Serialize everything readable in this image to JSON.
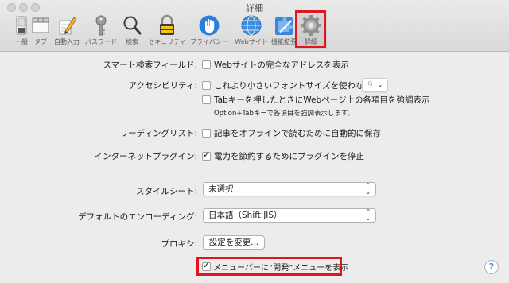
{
  "window": {
    "title": "詳細"
  },
  "toolbar": {
    "items": [
      {
        "label": "一般"
      },
      {
        "label": "タブ"
      },
      {
        "label": "自動入力"
      },
      {
        "label": "パスワード"
      },
      {
        "label": "検索"
      },
      {
        "label": "セキュリティ"
      },
      {
        "label": "プライバシー"
      },
      {
        "label": "Webサイト"
      },
      {
        "label": "機能拡張"
      },
      {
        "label": "詳細"
      }
    ],
    "active_index": 9
  },
  "settings": {
    "smart_search": {
      "label": "スマート検索フィールド:",
      "option": "Webサイトの完全なアドレスを表示",
      "checked": false
    },
    "accessibility": {
      "label": "アクセシビリティ:",
      "option1": "これより小さいフォントサイズを使わない:",
      "option1_checked": false,
      "font_size": "9",
      "option2": "Tabキーを押したときにWebページ上の各項目を強調表示",
      "option2_checked": false,
      "note": "Option+Tabキーで各項目を強調表示します。"
    },
    "reading_list": {
      "label": "リーディングリスト:",
      "option": "記事をオフラインで読むために自動的に保存",
      "checked": false
    },
    "plugins": {
      "label": "インターネットプラグイン:",
      "option": "電力を節約するためにプラグインを停止",
      "checked": true
    },
    "stylesheet": {
      "label": "スタイルシート:",
      "value": "未選択"
    },
    "encoding": {
      "label": "デフォルトのエンコーディング:",
      "value": "日本語（Shift JIS）"
    },
    "proxy": {
      "label": "プロキシ:",
      "button": "設定を変更..."
    },
    "develop_menu": {
      "option": "メニューバーに“開発”メニューを表示",
      "checked": true
    }
  },
  "help": {
    "glyph": "?"
  },
  "colors": {
    "highlight": "#e3141b",
    "accent": "#3b8bd9"
  }
}
